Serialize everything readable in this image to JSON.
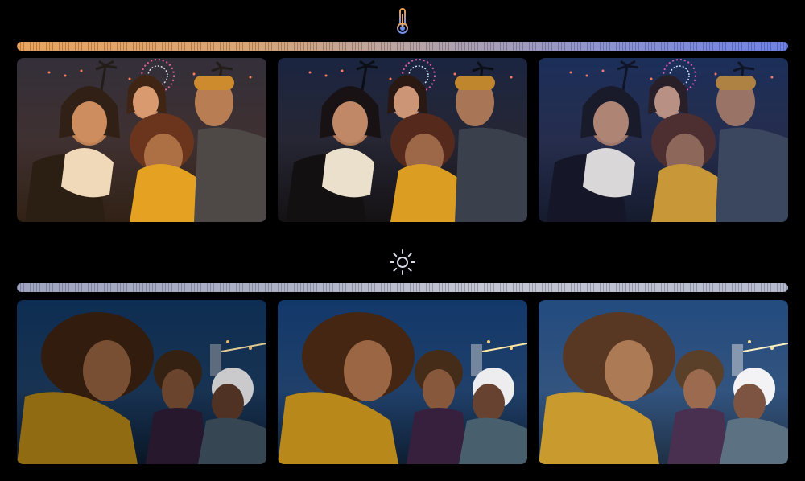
{
  "temperature": {
    "icon": "thermometer-icon",
    "slider_colors": [
      "#e9a35d",
      "#6e82e8"
    ],
    "photos": [
      {
        "tone": "warm"
      },
      {
        "tone": "neutral"
      },
      {
        "tone": "cool"
      }
    ]
  },
  "brightness": {
    "icon": "sun-icon",
    "slider_colors": [
      "#9fa4c2",
      "#c3c6d3"
    ],
    "photos": [
      {
        "tone": "dim"
      },
      {
        "tone": "normal"
      },
      {
        "tone": "bright"
      }
    ]
  }
}
